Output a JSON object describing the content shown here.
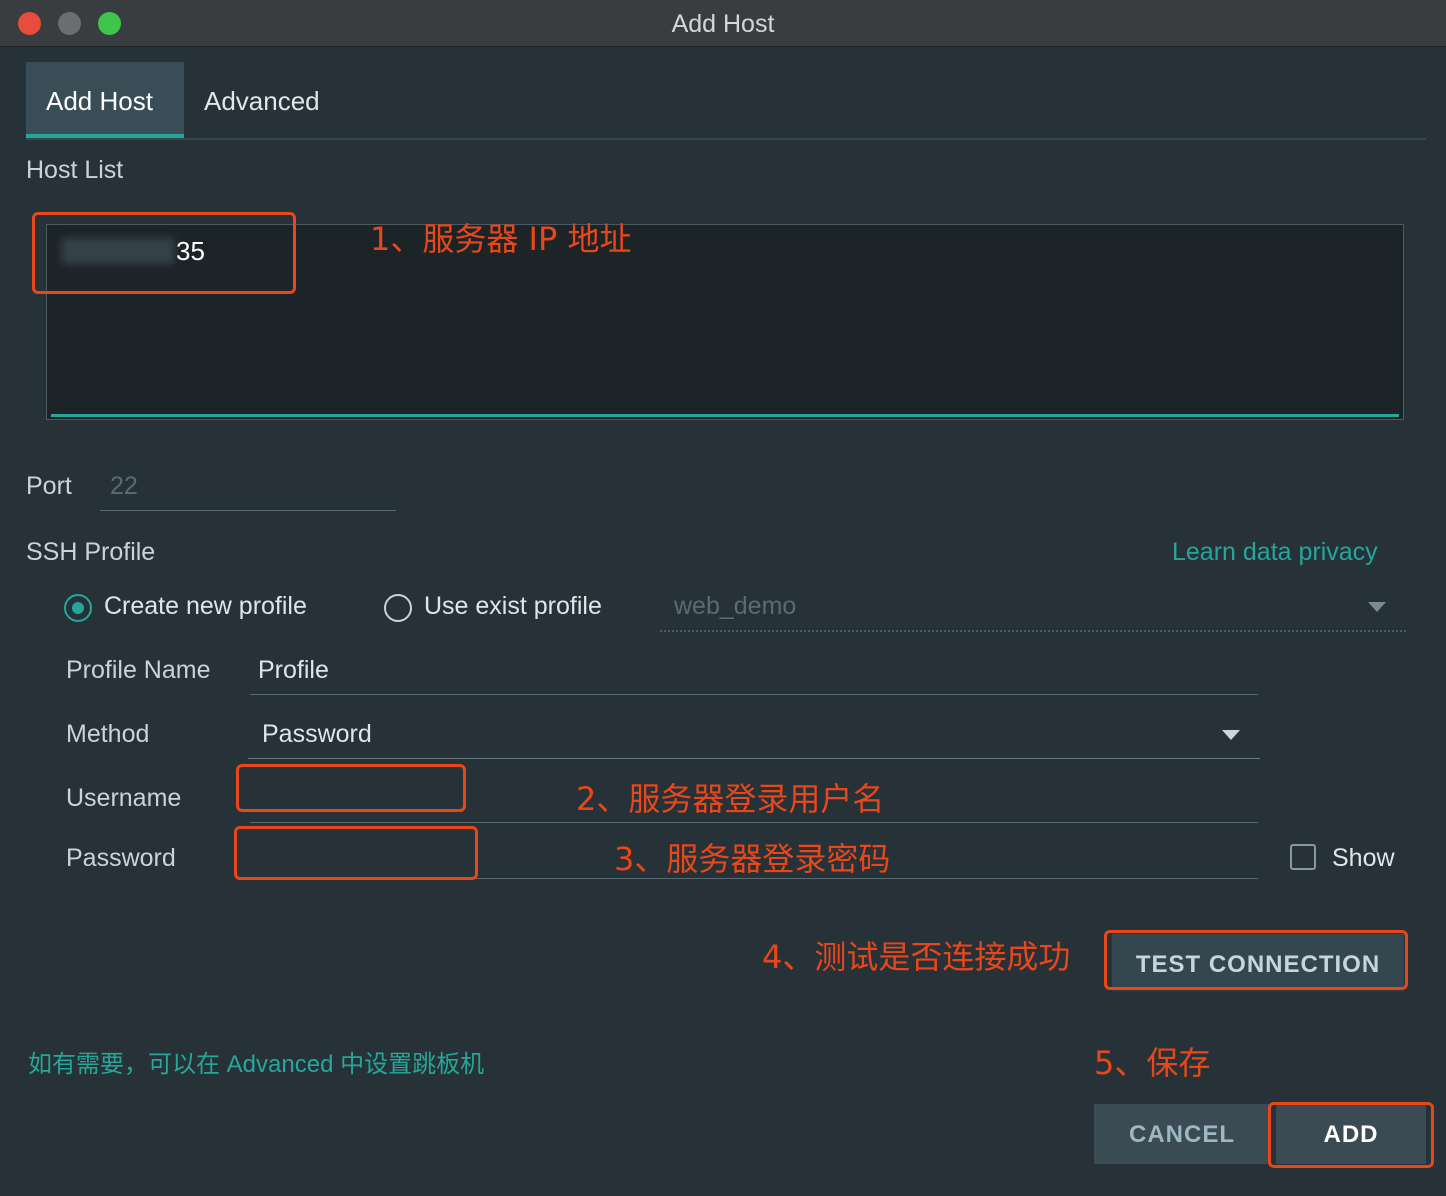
{
  "window": {
    "title": "Add Host"
  },
  "tabs": [
    {
      "label": "Add Host",
      "active": true
    },
    {
      "label": "Advanced",
      "active": false
    }
  ],
  "host_list": {
    "label": "Host List",
    "value": "35"
  },
  "port": {
    "label": "Port",
    "placeholder": "22"
  },
  "ssh_profile": {
    "label": "SSH Profile",
    "privacy_link": "Learn data privacy",
    "options": [
      {
        "label": "Create new profile",
        "selected": true
      },
      {
        "label": "Use exist profile",
        "selected": false
      }
    ],
    "exist_profile_value": "web_demo"
  },
  "profile_name": {
    "label": "Profile Name",
    "value": "Profile"
  },
  "method": {
    "label": "Method",
    "value": "Password"
  },
  "username": {
    "label": "Username",
    "value": ""
  },
  "password": {
    "label": "Password",
    "value": "",
    "show_label": "Show"
  },
  "buttons": {
    "test_connection": "TEST CONNECTION",
    "cancel": "CANCEL",
    "add": "ADD"
  },
  "hint": "如有需要，可以在 Advanced 中设置跳板机",
  "annotations": [
    "1、服务器 IP 地址",
    "2、服务器登录用户名",
    "3、服务器登录密码",
    "4、测试是否连接成功",
    "5、保存"
  ],
  "colors": {
    "accent": "#26a69a",
    "annotation": "#e8471a",
    "background": "#263238"
  }
}
